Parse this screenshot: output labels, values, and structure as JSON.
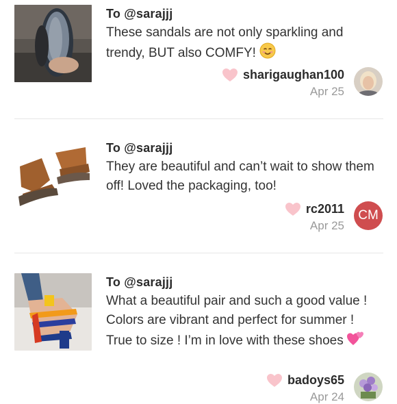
{
  "reviews": [
    {
      "to": "To @sarajjj",
      "text": "These sandals are not only sparkling and trendy, BUT also COMFY!",
      "emoji": "smiling-face-icon",
      "username": "sharigaughan100",
      "date": "Apr 25",
      "avatar_type": "photo"
    },
    {
      "to": "To @sarajjj",
      "text": "They are beautiful and can’t wait to show them off! Loved the packaging, too!",
      "username": "rc2011",
      "date": "Apr 25",
      "avatar_initials": "CM",
      "avatar_color": "#cf4d4f"
    },
    {
      "to": "To @sarajjj",
      "text": "What a beautiful pair and such a good value ! Colors are vibrant and perfect for summer ! True to size ! I’m in love with these shoes",
      "emoji": "two-hearts-icon",
      "username": "badoys65",
      "date": "Apr 24",
      "avatar_type": "photo"
    }
  ],
  "colors": {
    "heart": "#f9c4cb",
    "date": "#999999",
    "divider": "#e6e6e6"
  }
}
